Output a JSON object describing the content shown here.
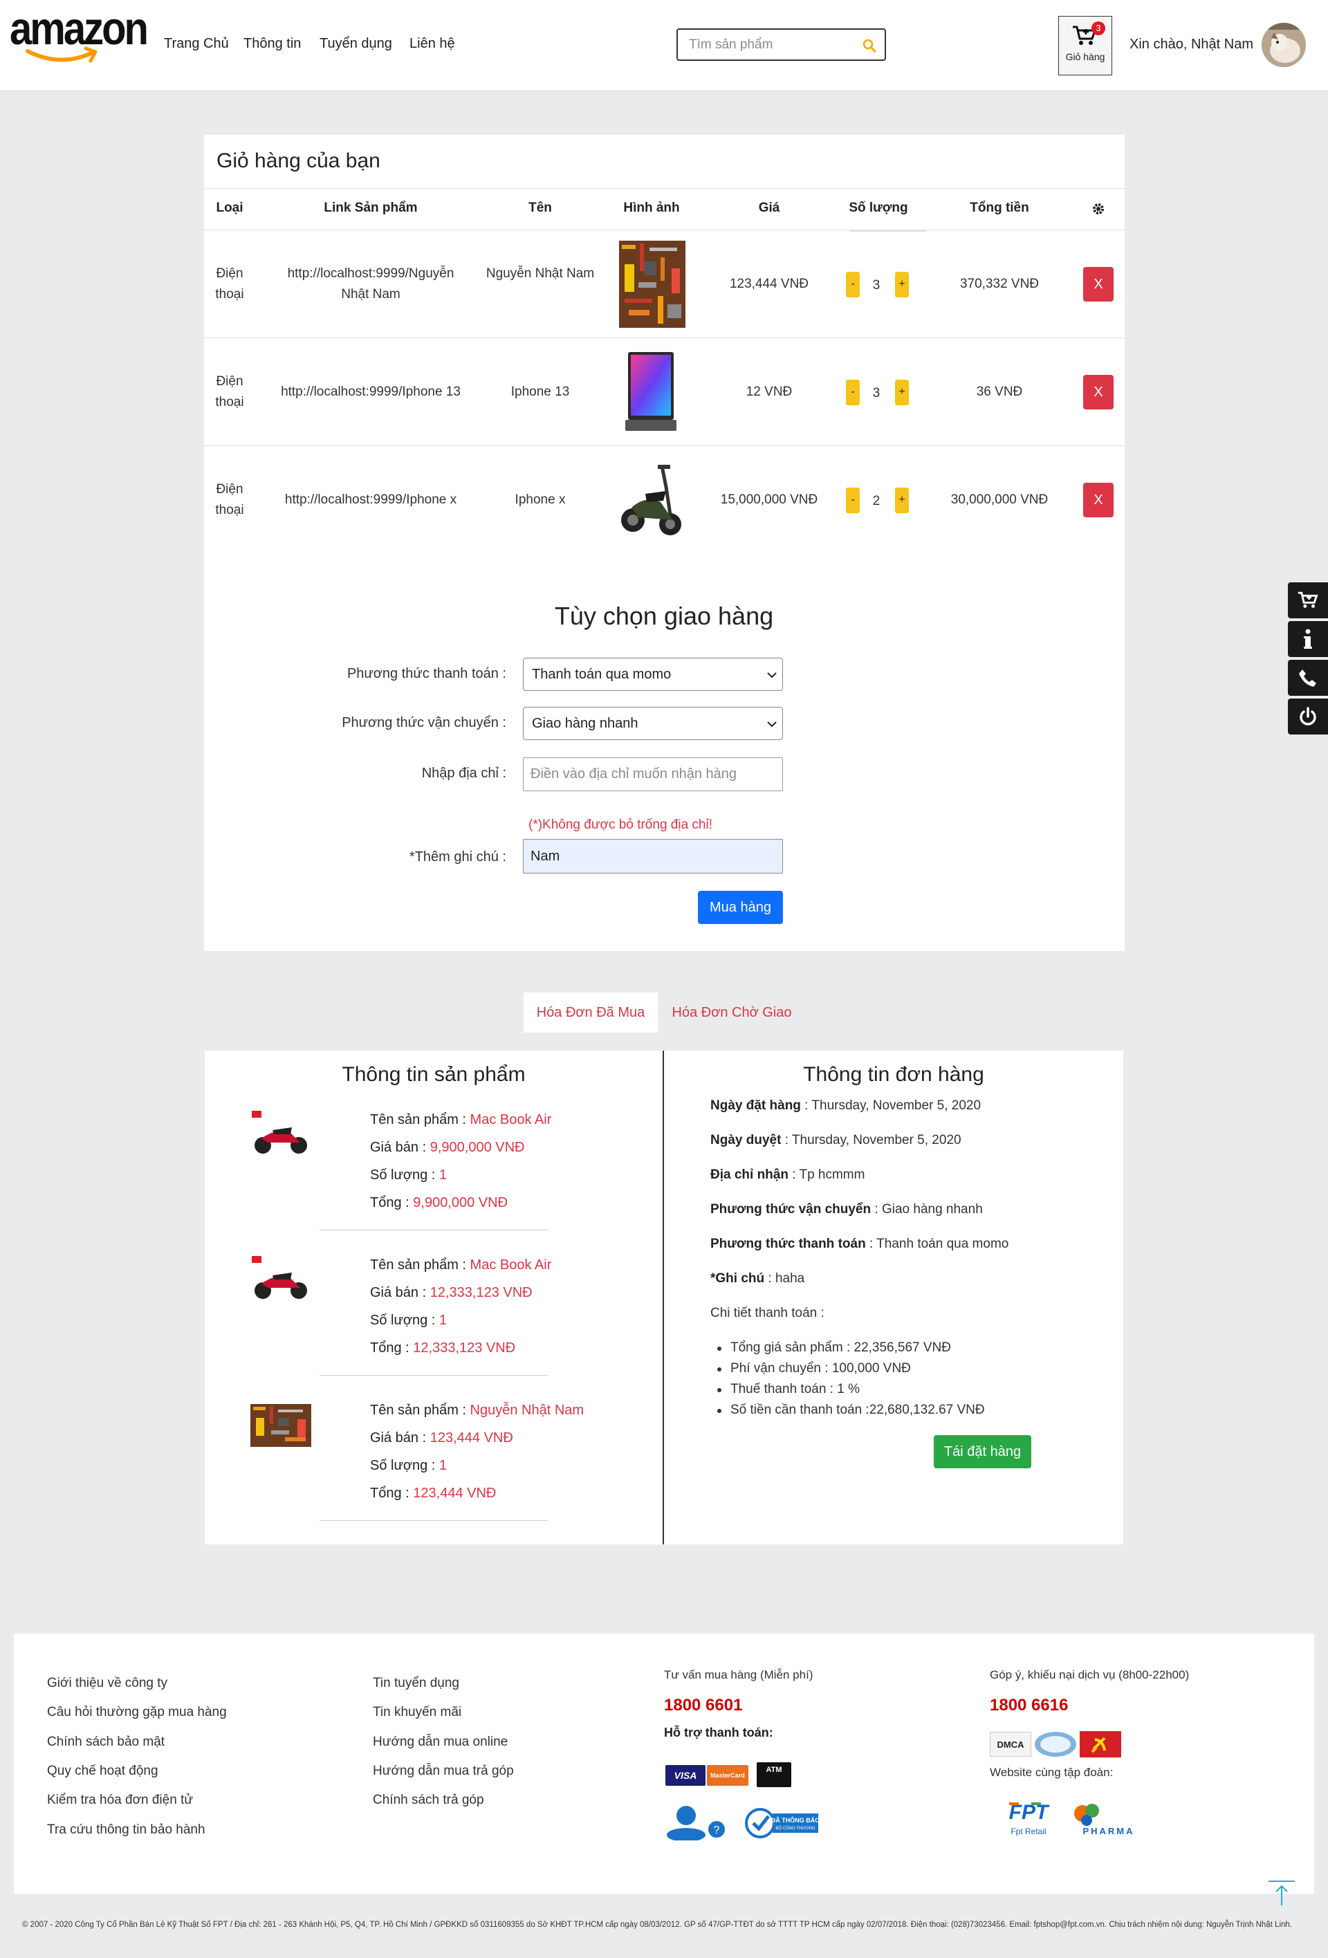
{
  "brand": {
    "logo_text": "amazon"
  },
  "nav": {
    "items": [
      "Trang Chủ",
      "Thông tin",
      "Tuyển dụng",
      "Liên hệ"
    ]
  },
  "search": {
    "placeholder": "Tìm sản phẩm"
  },
  "cart_button": {
    "label": "Giỏ hàng",
    "count": "3"
  },
  "user": {
    "greeting": "Xin chào, Nhật Nam"
  },
  "cart": {
    "title": "Giỏ hàng của bạn",
    "columns": [
      "Loại",
      "Link Sản phẩm",
      "Tên",
      "Hình ảnh",
      "Giá",
      "Số lượng",
      "Tổng tiền"
    ],
    "rows": [
      {
        "type": "Điện thoại",
        "link": "http://localhost:9999/Nguyễn Nhật Nam",
        "name": "Nguyễn Nhật Nam",
        "image": "tools-image",
        "price": "123,444 VNĐ",
        "qty": "3",
        "total": "370,332 VNĐ"
      },
      {
        "type": "Điện thoại",
        "link": "http://localhost:9999/Iphone 13",
        "name": "Iphone 13",
        "image": "laptop-image",
        "price": "12 VNĐ",
        "qty": "3",
        "total": "36 VNĐ"
      },
      {
        "type": "Điện thoại",
        "link": "http://localhost:9999/Iphone x",
        "name": "Iphone x",
        "image": "scooter-image",
        "price": "15,000,000 VNĐ",
        "qty": "2",
        "total": "30,000,000 VNĐ"
      }
    ],
    "minus": "-",
    "plus": "+",
    "delete": "X"
  },
  "delivery": {
    "title": "Tùy chọn giao hàng",
    "payment_label": "Phương thức thanh toán :",
    "payment_value": "Thanh toán qua momo",
    "shipping_label": "Phương thức vận chuyển :",
    "shipping_value": "Giao hàng nhanh",
    "address_label": "Nhập địa chỉ :",
    "address_placeholder": "Điền vào địa chỉ muốn nhận hàng",
    "address_error": "(*)Không được bỏ trống địa chỉ!",
    "note_label": "*Thêm ghi chú :",
    "note_value": "Nam",
    "submit": "Mua hàng"
  },
  "tabs": [
    "Hóa Đơn Đã Mua",
    "Hóa Đơn Chờ Giao"
  ],
  "order": {
    "products_title": "Thông tin sản phẩm",
    "labels": {
      "name": "Tên sản phẩm : ",
      "price": "Giá bán : ",
      "qty": "Số lượng : ",
      "total": "Tổng : "
    },
    "products": [
      {
        "thumb": "motorbike-thumb",
        "name": "Mac Book Air",
        "price": "9,900,000 VNĐ",
        "qty": "1",
        "total": "9,900,000 VNĐ"
      },
      {
        "thumb": "motorbike-thumb",
        "name": "Mac Book Air",
        "price": "12,333,123 VNĐ",
        "qty": "1",
        "total": "12,333,123 VNĐ"
      },
      {
        "thumb": "tools-thumb",
        "name": "Nguyễn Nhật Nam",
        "price": "123,444 VNĐ",
        "qty": "1",
        "total": "123,444 VNĐ"
      }
    ],
    "info_title": "Thông tin đơn hàng",
    "info": [
      {
        "label": "Ngày đặt hàng",
        "value": " : Thursday, November 5, 2020"
      },
      {
        "label": "Ngày duyệt",
        "value": " : Thursday, November 5, 2020"
      },
      {
        "label": "Địa chỉ nhận",
        "value": " : Tp hcmmm"
      },
      {
        "label": "Phương thức vận chuyển",
        "value": " : Giao hàng nhanh"
      },
      {
        "label": "Phương thức thanh toán",
        "value": " : Thanh toán qua momo"
      },
      {
        "label": "*Ghi chú",
        "value": " : haha"
      }
    ],
    "detail_title": "Chi tiết thanh toán :",
    "details": [
      "Tổng giá sản phẩm : 22,356,567 VNĐ",
      "Phí vận chuyển : 100,000 VNĐ",
      "Thuế thanh toán : 1 %",
      "Số tiền cần thanh toán :22,680,132.67 VNĐ"
    ],
    "reorder": "Tái đặt hàng"
  },
  "footer": {
    "col1": [
      "Giới thiệu về công ty",
      "Câu hỏi thường gặp mua hàng",
      "Chính sách bảo mật",
      "Quy chế hoạt động",
      "Kiểm tra hóa đơn điện tử",
      "Tra cứu thông tin bảo hành"
    ],
    "col2": [
      "Tin tuyển dụng",
      "Tin khuyến mãi",
      "Hướng dẫn mua online",
      "Hướng dẫn mua trả góp",
      "Chính sách trả góp"
    ],
    "consult_title": "Tư vấn mua hàng (Miễn phí)",
    "consult_phone": "1800 6601",
    "payment_support": "Hỗ trợ thanh toán:",
    "feedback_title": "Góp ý, khiếu nại dịch vụ (8h00-22h00)",
    "feedback_phone": "1800 6616",
    "group_sites": "Website cùng tập đoàn:",
    "logos": {
      "visa": "VISA",
      "mastercard": "MasterCard",
      "atm": "ATM",
      "dmca": "DMCA",
      "bct": "ĐÃ THÔNG BÁO",
      "bct_sub": "BỘ CÔNG THƯƠNG",
      "fpt": "FPT",
      "fpt_sub": "Fpt Retail",
      "pharma": "PHARMA"
    },
    "copyright": "© 2007 - 2020 Công Ty Cổ Phần Bán Lẻ Kỹ Thuật Số FPT / Địa chỉ: 261 - 263 Khánh Hội, P5, Q4, TP. Hồ Chí Minh / GPĐKKD số 0311609355 do Sở KHĐT TP.HCM cấp ngày 08/03/2012. GP số 47/GP-TTĐT do sở TTTT TP HCM cấp ngày 02/07/2018. Điện thoại: (028)73023456. Email: fptshop@fpt.com.vn. Chịu trách nhiệm nội dung: Nguyễn Trịnh Nhật Linh."
  },
  "colors": {
    "accent_red": "#dc3545",
    "primary_blue": "#0d6efd",
    "success_green": "#28a745",
    "qty_yellow": "#f6c21c"
  }
}
